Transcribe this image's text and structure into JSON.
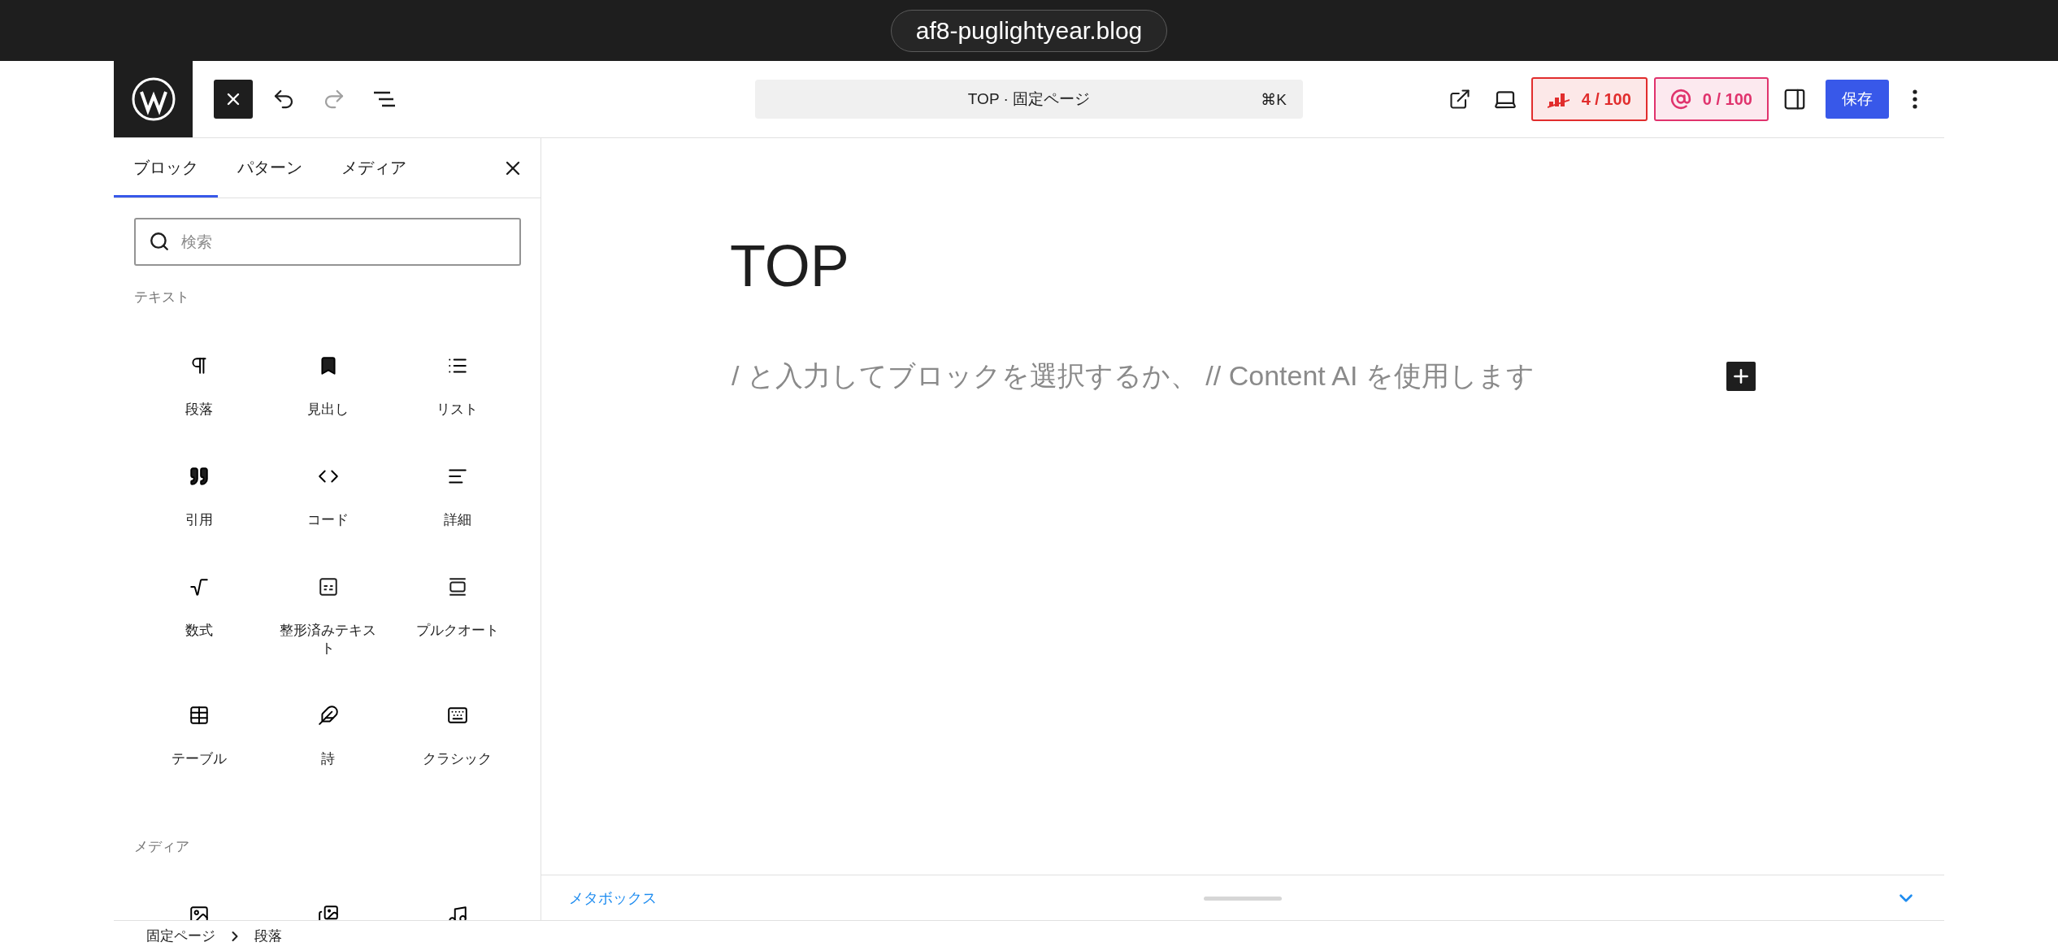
{
  "browser": {
    "url": "af8-puglightyear.blog"
  },
  "toolbar": {
    "undo": {
      "disabled": false
    },
    "redo": {
      "disabled": true
    }
  },
  "command_bar": {
    "title": "TOP · 固定ページ",
    "shortcut": "⌘K"
  },
  "badges": [
    {
      "kind": "seo",
      "text": "4 / 100",
      "color": "#e12d2d"
    },
    {
      "kind": "ai",
      "text": "0 / 100",
      "color": "#e0336d"
    }
  ],
  "save_button": "保存",
  "inserter": {
    "tabs": [
      {
        "label": "ブロック",
        "selected": true
      },
      {
        "label": "パターン",
        "selected": false
      },
      {
        "label": "メディア",
        "selected": false
      }
    ],
    "search": {
      "placeholder": "検索"
    },
    "sections": [
      {
        "title": "テキスト",
        "blocks": [
          {
            "kind": "paragraph",
            "label": "段落"
          },
          {
            "kind": "heading",
            "label": "見出し"
          },
          {
            "kind": "list",
            "label": "リスト"
          },
          {
            "kind": "quote",
            "label": "引用"
          },
          {
            "kind": "code",
            "label": "コード"
          },
          {
            "kind": "details",
            "label": "詳細"
          },
          {
            "kind": "math",
            "label": "数式"
          },
          {
            "kind": "preformatted",
            "label": "整形済みテキスト"
          },
          {
            "kind": "pullquote",
            "label": "プルクオート"
          },
          {
            "kind": "table",
            "label": "テーブル"
          },
          {
            "kind": "verse",
            "label": "詩"
          },
          {
            "kind": "classic",
            "label": "クラシック"
          }
        ]
      },
      {
        "title": "メディア",
        "blocks": [
          {
            "kind": "image"
          },
          {
            "kind": "gallery"
          },
          {
            "kind": "audio"
          }
        ]
      }
    ]
  },
  "editor": {
    "title": "TOP",
    "placeholder": "/ と入力してブロックを選択するか、 // Content AI を使用します"
  },
  "metabox": {
    "label": "メタボックス"
  },
  "breadcrumb": [
    "固定ページ",
    "段落"
  ]
}
